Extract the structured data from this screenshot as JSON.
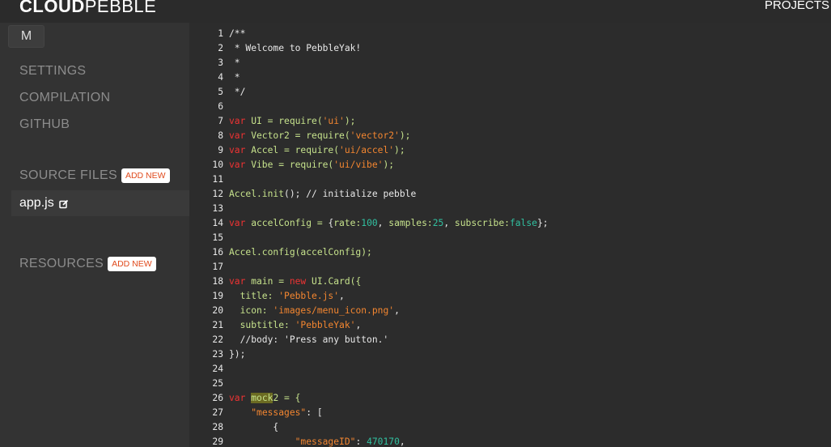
{
  "header": {
    "logo_bold": "CLOUD",
    "logo_light": "PEBBLE",
    "projects_label": "PROJECTS"
  },
  "sidebar": {
    "m_button": "M",
    "nav": [
      "SETTINGS",
      "COMPILATION",
      "GITHUB"
    ],
    "source_files_label": "SOURCE FILES",
    "add_new_label": "ADD NEW",
    "active_file": "app.js",
    "resources_label": "RESOURCES"
  },
  "editor": {
    "lines": [
      {
        "n": "1",
        "t": [
          [
            "c-com",
            "/**"
          ]
        ]
      },
      {
        "n": "2",
        "t": [
          [
            "c-com",
            " * Welcome to PebbleYak!"
          ]
        ]
      },
      {
        "n": "3",
        "t": [
          [
            "c-com",
            " *"
          ]
        ]
      },
      {
        "n": "4",
        "t": [
          [
            "c-com",
            " *"
          ]
        ]
      },
      {
        "n": "5",
        "t": [
          [
            "c-com",
            " */"
          ]
        ]
      },
      {
        "n": "6",
        "t": []
      },
      {
        "n": "7",
        "t": [
          [
            "c-kw",
            "var"
          ],
          [
            "c-fn",
            " UI = require("
          ],
          [
            "c-str",
            "'ui'"
          ],
          [
            "c-fn",
            ");"
          ]
        ]
      },
      {
        "n": "8",
        "t": [
          [
            "c-kw",
            "var"
          ],
          [
            "c-fn",
            " Vector2 = require("
          ],
          [
            "c-str",
            "'vector2'"
          ],
          [
            "c-fn",
            ");"
          ]
        ]
      },
      {
        "n": "9",
        "t": [
          [
            "c-kw",
            "var"
          ],
          [
            "c-fn",
            " Accel = require("
          ],
          [
            "c-str",
            "'ui/accel'"
          ],
          [
            "c-fn",
            ");"
          ]
        ]
      },
      {
        "n": "10",
        "t": [
          [
            "c-kw",
            "var"
          ],
          [
            "c-fn",
            " Vibe = require("
          ],
          [
            "c-str",
            "'ui/vibe'"
          ],
          [
            "c-fn",
            ");"
          ]
        ]
      },
      {
        "n": "11",
        "t": []
      },
      {
        "n": "12",
        "t": [
          [
            "c-fn",
            "Accel.init"
          ],
          [
            "c-plain",
            "(); // initialize pebble"
          ]
        ]
      },
      {
        "n": "13",
        "t": []
      },
      {
        "n": "14",
        "t": [
          [
            "c-kw",
            "var"
          ],
          [
            "c-fn",
            " accelConfig = "
          ],
          [
            "c-plain",
            "{"
          ],
          [
            "c-fn",
            "rate:"
          ],
          [
            "c-num",
            "100"
          ],
          [
            "c-plain",
            ", "
          ],
          [
            "c-fn",
            "samples:"
          ],
          [
            "c-num",
            "25"
          ],
          [
            "c-plain",
            ", "
          ],
          [
            "c-fn",
            "subscribe:"
          ],
          [
            "c-num",
            "false"
          ],
          [
            "c-plain",
            "};"
          ]
        ]
      },
      {
        "n": "15",
        "t": []
      },
      {
        "n": "16",
        "t": [
          [
            "c-fn",
            "Accel.config(accelConfig);"
          ]
        ]
      },
      {
        "n": "17",
        "t": []
      },
      {
        "n": "18",
        "t": [
          [
            "c-kw",
            "var"
          ],
          [
            "c-fn",
            " main = "
          ],
          [
            "c-kw",
            "new"
          ],
          [
            "c-fn",
            " UI.Card({"
          ]
        ]
      },
      {
        "n": "19",
        "t": [
          [
            "c-fn",
            "  title: "
          ],
          [
            "c-str",
            "'Pebble.js'"
          ],
          [
            "c-plain",
            ","
          ]
        ]
      },
      {
        "n": "20",
        "t": [
          [
            "c-fn",
            "  icon: "
          ],
          [
            "c-str",
            "'images/menu_icon.png'"
          ],
          [
            "c-plain",
            ","
          ]
        ]
      },
      {
        "n": "21",
        "t": [
          [
            "c-fn",
            "  subtitle: "
          ],
          [
            "c-str",
            "'PebbleYak'"
          ],
          [
            "c-plain",
            ","
          ]
        ]
      },
      {
        "n": "22",
        "t": [
          [
            "c-plain",
            "  //body: 'Press any button.'"
          ]
        ]
      },
      {
        "n": "23",
        "t": [
          [
            "c-plain",
            "});"
          ]
        ]
      },
      {
        "n": "24",
        "t": []
      },
      {
        "n": "25",
        "t": []
      },
      {
        "n": "26",
        "t": [
          [
            "c-kw",
            "var"
          ],
          [
            "c-plain",
            " "
          ],
          [
            "c-hl",
            "mock"
          ],
          [
            "c-fn",
            "2 = {"
          ]
        ]
      },
      {
        "n": "27",
        "t": [
          [
            "c-plain",
            "    "
          ],
          [
            "c-str",
            "\"messages\""
          ],
          [
            "c-plain",
            ": ["
          ]
        ]
      },
      {
        "n": "28",
        "t": [
          [
            "c-plain",
            "        {"
          ]
        ]
      },
      {
        "n": "29",
        "t": [
          [
            "c-plain",
            "            "
          ],
          [
            "c-str",
            "\"messageID\""
          ],
          [
            "c-plain",
            ": "
          ],
          [
            "c-num",
            "470170"
          ],
          [
            "c-plain",
            ","
          ]
        ]
      }
    ]
  }
}
